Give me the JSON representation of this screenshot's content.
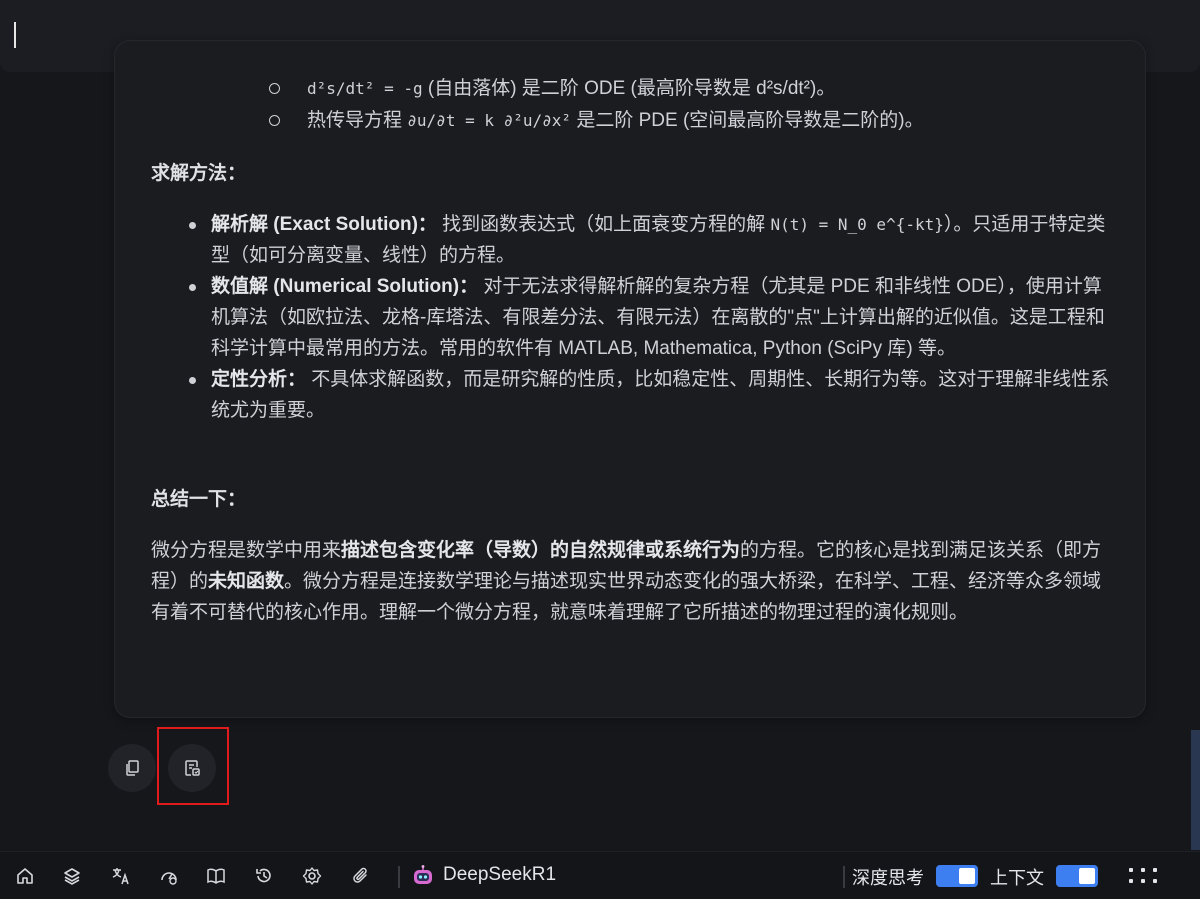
{
  "top_input": {
    "value": ""
  },
  "answer": {
    "sub_items": [
      {
        "formula": "d²s/dt² = -g",
        "text": " (自由落体) 是二阶 ODE (最高阶导数是 d²s/dt²)。"
      },
      {
        "prefix": "热传导方程 ",
        "formula": "∂u/∂t = k ∂²u/∂x²",
        "text": " 是二阶 PDE (空间最高阶导数是二阶的)。"
      }
    ],
    "methods_heading": "求解方法：",
    "methods": [
      {
        "bold": "解析解 (Exact Solution)：",
        "text_a": " 找到函数表达式（如上面衰变方程的解 ",
        "formula": "N(t) = N_0 e^{-kt}",
        "text_b": "）。只适用于特定类型（如可分离变量、线性）的方程。"
      },
      {
        "bold": "数值解 (Numerical Solution)：",
        "text": " 对于无法求得解析解的复杂方程（尤其是 PDE 和非线性 ODE），使用计算机算法（如欧拉法、龙格-库塔法、有限差分法、有限元法）在离散的\"点\"上计算出解的近似值。这是工程和科学计算中最常用的方法。常用的软件有 MATLAB, Mathematica, Python (SciPy 库) 等。"
      },
      {
        "bold": "定性分析：",
        "text": " 不具体求解函数，而是研究解的性质，比如稳定性、周期性、长期行为等。这对于理解非线性系统尤为重要。"
      }
    ],
    "summary_heading": "总结一下：",
    "summary": {
      "p1": "微分方程是数学中用来",
      "b1": "描述包含变化率（导数）的自然规律或系统行为",
      "p2": "的方程。它的核心是找到满足该关系（即方程）的",
      "b2": "未知函数",
      "p3": "。微分方程是连接数学理论与描述现实世界动态变化的强大桥梁，在科学、工程、经济等众多领域有着不可替代的核心作用。理解一个微分方程，就意味着理解了它所描述的物理过程的演化规则。"
    }
  },
  "actions": [
    {
      "name": "copy",
      "icon": "copy-icon"
    },
    {
      "name": "export-note",
      "icon": "note-export-icon"
    }
  ],
  "bottom_bar": {
    "icons": [
      "home-icon",
      "layers-icon",
      "translate-icon",
      "dashboard-icon",
      "book-icon",
      "history-icon",
      "settings-icon",
      "attachment-icon"
    ],
    "model": "DeepSeekR1",
    "deep_think_label": "深度思考",
    "deep_think_on": true,
    "context_label": "上下文",
    "context_on": true,
    "menu_icon": "grid-menu-icon"
  }
}
